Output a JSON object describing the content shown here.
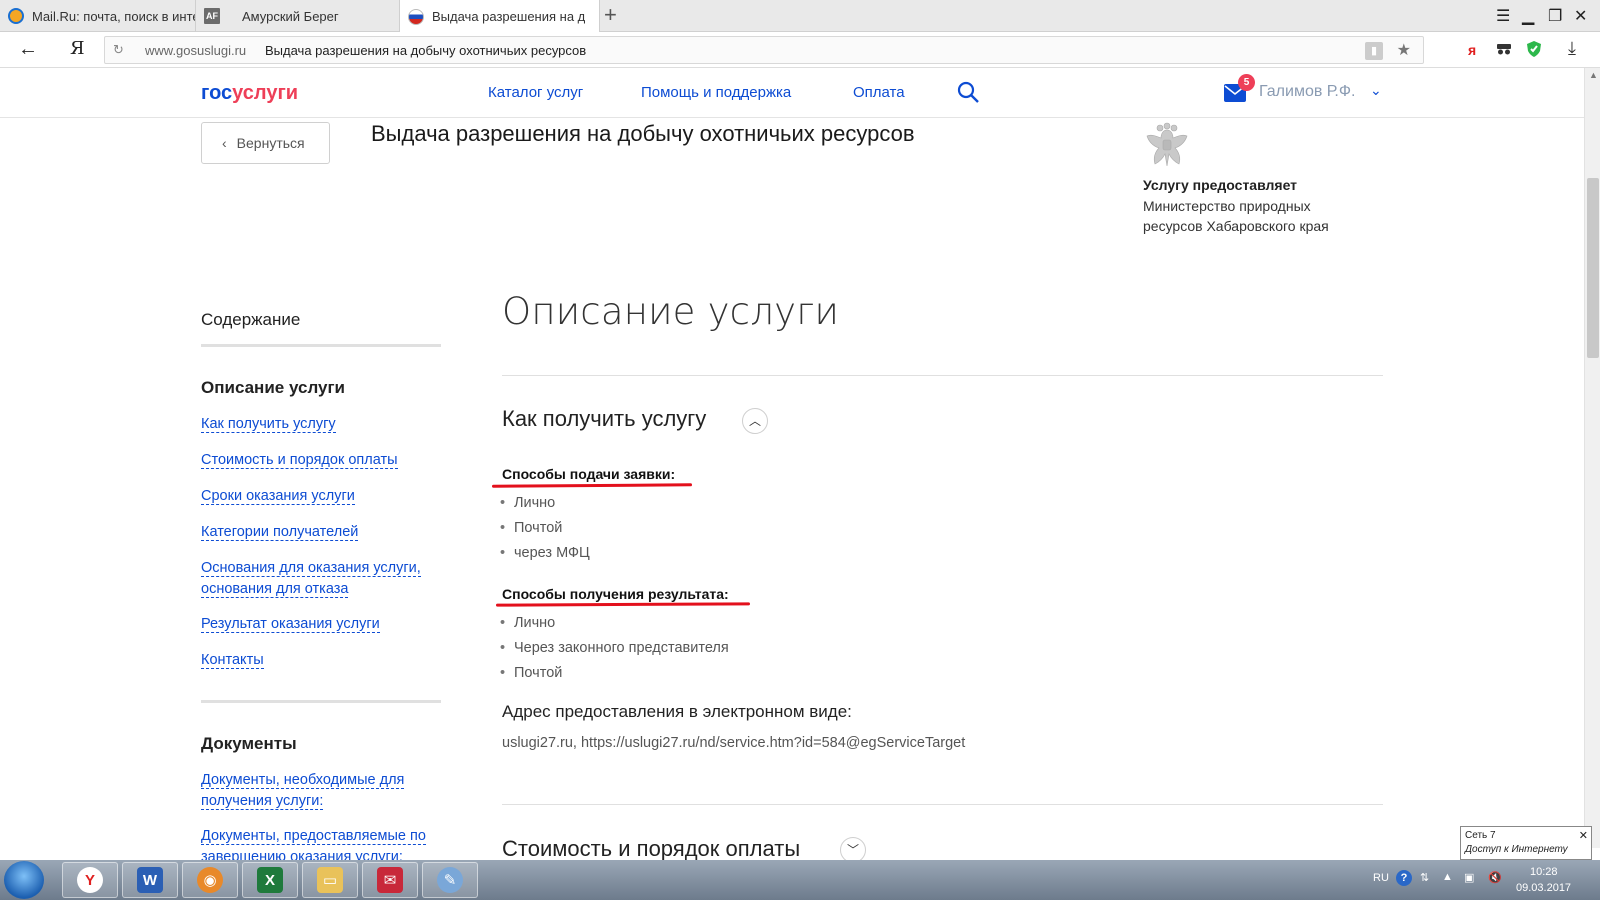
{
  "browser": {
    "tabs": [
      {
        "title": "Mail.Ru: почта, поиск в инте",
        "icon": "mailru-icon"
      },
      {
        "title": "Амурский Берег",
        "icon": "af-icon"
      },
      {
        "title": "Выдача разрешения на д",
        "icon": "russian-flag-icon"
      }
    ],
    "yandex_letter": "Я",
    "url_domain": "www.gosuslugi.ru",
    "url_page_title": "Выдача разрешения на добычу охотничьих ресурсов",
    "ext_ya": "я"
  },
  "site": {
    "logo_gos": "гос",
    "logo_uslugi": "услуги",
    "menu": [
      "Каталог услуг",
      "Помощь и поддержка",
      "Оплата"
    ],
    "mail_count": "5",
    "user_name": "Галимов Р.Ф.",
    "accent_color": "#0d4cd3",
    "brand_red": "#ee3f58"
  },
  "page": {
    "back_label": "Вернуться",
    "service_title": "Выдача разрешения на добычу охотничьих ресурсов",
    "provider_head": "Услугу предоставляет",
    "provider_name": "Министерство природных ресурсов Хабаровского края",
    "toc": {
      "title": "Содержание",
      "section1": "Описание услуги",
      "links1": [
        "Как получить услугу",
        "Стоимость и порядок оплаты",
        "Сроки оказания услуги",
        "Категории получателей",
        "Основания для оказания услуги, основания для отказа",
        "Результат оказания услуги",
        "Контакты"
      ],
      "section2": "Документы",
      "links2": [
        "Документы, необходимые для получения услуги:",
        "Документы, предоставляемые по завершению оказания услуги:"
      ]
    },
    "main_heading": "Описание услуги",
    "how_to_title": "Как получить услугу",
    "submit_methods_title": "Способы подачи заявки:",
    "submit_methods": [
      "Лично",
      "Почтой",
      "через МФЦ"
    ],
    "result_methods_title": "Способы получения результата:",
    "result_methods": [
      "Лично",
      "Через законного представителя",
      "Почтой"
    ],
    "address_title": "Адрес предоставления в электронном виде:",
    "address_value": "uslugi27.ru, https://uslugi27.ru/nd/service.htm?id=584@egServiceTarget",
    "cost_title": "Стоимость и порядок оплаты"
  },
  "tooltip": {
    "line1": "Сеть  7",
    "line2": "Доступ к Интернету"
  },
  "taskbar": {
    "lang": "RU",
    "time": "10:28",
    "date": "09.03.2017"
  }
}
